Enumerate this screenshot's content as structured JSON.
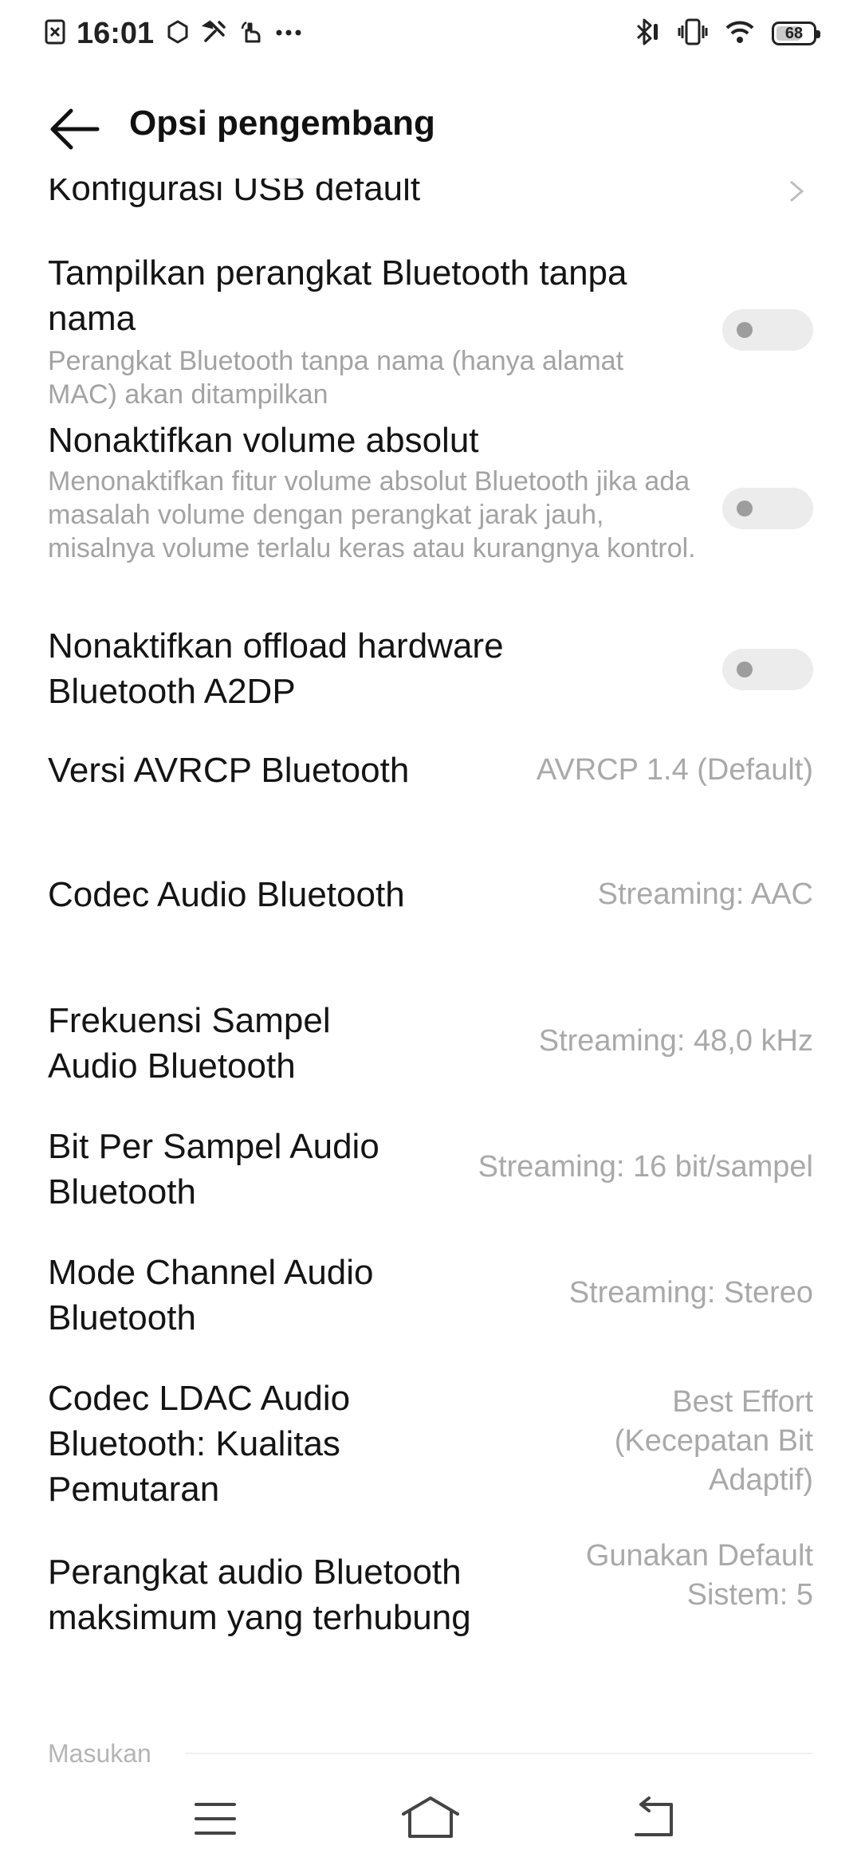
{
  "status_bar": {
    "time": "16:01",
    "battery": "68",
    "battery_level": 0.68,
    "left_icons": [
      "notification-x-icon",
      "circle-icon",
      "tools-icon",
      "hand-icon",
      "more-dots-icon"
    ],
    "right_icons": [
      "bluetooth-icon",
      "vibrate-icon",
      "wifi-icon",
      "battery-icon"
    ]
  },
  "header": {
    "title": "Opsi pengembang"
  },
  "items": {
    "usb_config": {
      "title": "Konfigurasi USB default"
    },
    "show_unnamed": {
      "title": "Tampilkan perangkat Bluetooth tanpa nama",
      "subtitle": "Perangkat Bluetooth tanpa nama (hanya alamat MAC) akan ditampilkan",
      "enabled": false
    },
    "disable_absolute_volume": {
      "title": "Nonaktifkan volume absolut",
      "subtitle": "Menonaktifkan fitur volume absolut Bluetooth jika ada masalah volume dengan perangkat jarak jauh, misalnya volume terlalu keras atau kurangnya kontrol.",
      "enabled": false
    },
    "disable_a2dp_offload": {
      "title": "Nonaktifkan offload hardware Bluetooth A2DP",
      "enabled": false
    },
    "avrcp": {
      "title": "Versi AVRCP Bluetooth",
      "value": "AVRCP 1.4 (Default)"
    },
    "codec": {
      "title": "Codec Audio Bluetooth",
      "value": "Streaming: AAC"
    },
    "sample_rate": {
      "title": "Frekuensi Sampel Audio Bluetooth",
      "value": "Streaming: 48,0 kHz"
    },
    "bits_per_sample": {
      "title": "Bit Per Sampel Audio Bluetooth",
      "value": "Streaming: 16 bit/sampel"
    },
    "channel_mode": {
      "title": "Mode Channel Audio Bluetooth",
      "value": "Streaming: Stereo"
    },
    "ldac": {
      "title": "Codec LDAC Audio Bluetooth: Kualitas Pemutaran",
      "value": "Best Effort (Kecepatan Bit Adaptif)"
    },
    "max_devices": {
      "title": "Perangkat audio Bluetooth maksimum yang terhubung",
      "value": "Gunakan Default Sistem: 5"
    }
  },
  "section": {
    "label": "Masukan"
  },
  "navbar": {
    "buttons": [
      "menu-icon",
      "home-icon",
      "back-icon"
    ]
  }
}
